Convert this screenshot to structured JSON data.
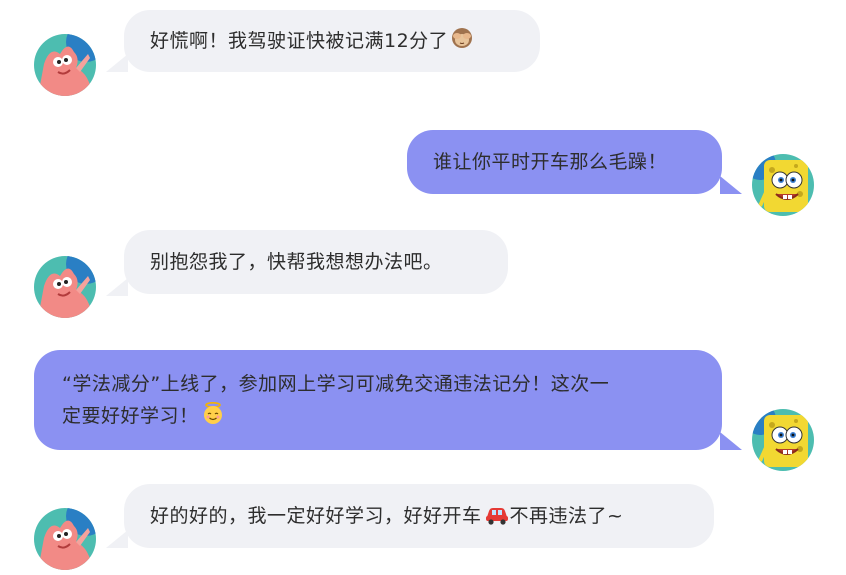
{
  "messages": [
    {
      "sender": "patrick",
      "side": "left",
      "text": "好慌啊！我驾驶证快被记满12分了",
      "emoji": "see-no-evil-monkey"
    },
    {
      "sender": "spongebob",
      "side": "right",
      "text": "谁让你平时开车那么毛躁！",
      "emoji": ""
    },
    {
      "sender": "patrick",
      "side": "left",
      "text": "别抱怨我了，快帮我想想办法吧。",
      "emoji": ""
    },
    {
      "sender": "spongebob",
      "side": "right",
      "text_line1": "“学法减分”上线了，参加网上学习可减免交通违法记分！这次一",
      "text_line2": "定要好好学习！",
      "emoji": "smiling-face-with-halo"
    },
    {
      "sender": "patrick",
      "side": "left",
      "text_before": "好的好的，我一定好好学习，好好开车",
      "text_after": "不再违法了~",
      "emoji": "car"
    }
  ],
  "colors": {
    "left_bubble": "#f0f1f5",
    "right_bubble": "#8b91f2",
    "text": "#2d2d2d",
    "patrick_skin": "#f28a86",
    "spongebob_yellow": "#f2d832",
    "avatar_bg_teal": "#3fb6a8"
  }
}
